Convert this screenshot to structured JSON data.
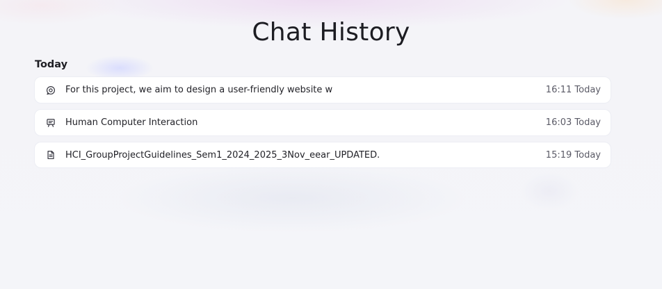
{
  "header": {
    "title": "Chat History"
  },
  "sections": [
    {
      "label": "Today",
      "items": [
        {
          "icon": "chat-bubble-icon",
          "title": "For this project, we aim to design a user-friendly website w",
          "time": "16:11 Today"
        },
        {
          "icon": "presentation-board-icon",
          "title": "Human Computer Interaction",
          "time": "16:03 Today"
        },
        {
          "icon": "document-icon",
          "title": "HCI_GroupProjectGuidelines_Sem1_2024_2025_3Nov_eear_UPDATED.",
          "time": "15:19 Today"
        }
      ]
    }
  ],
  "colors": {
    "background": "#f3f4f8",
    "card": "#ffffff",
    "text_primary": "#1f1f24",
    "text_secondary": "#5a5a66",
    "icon": "#3a3a44"
  }
}
